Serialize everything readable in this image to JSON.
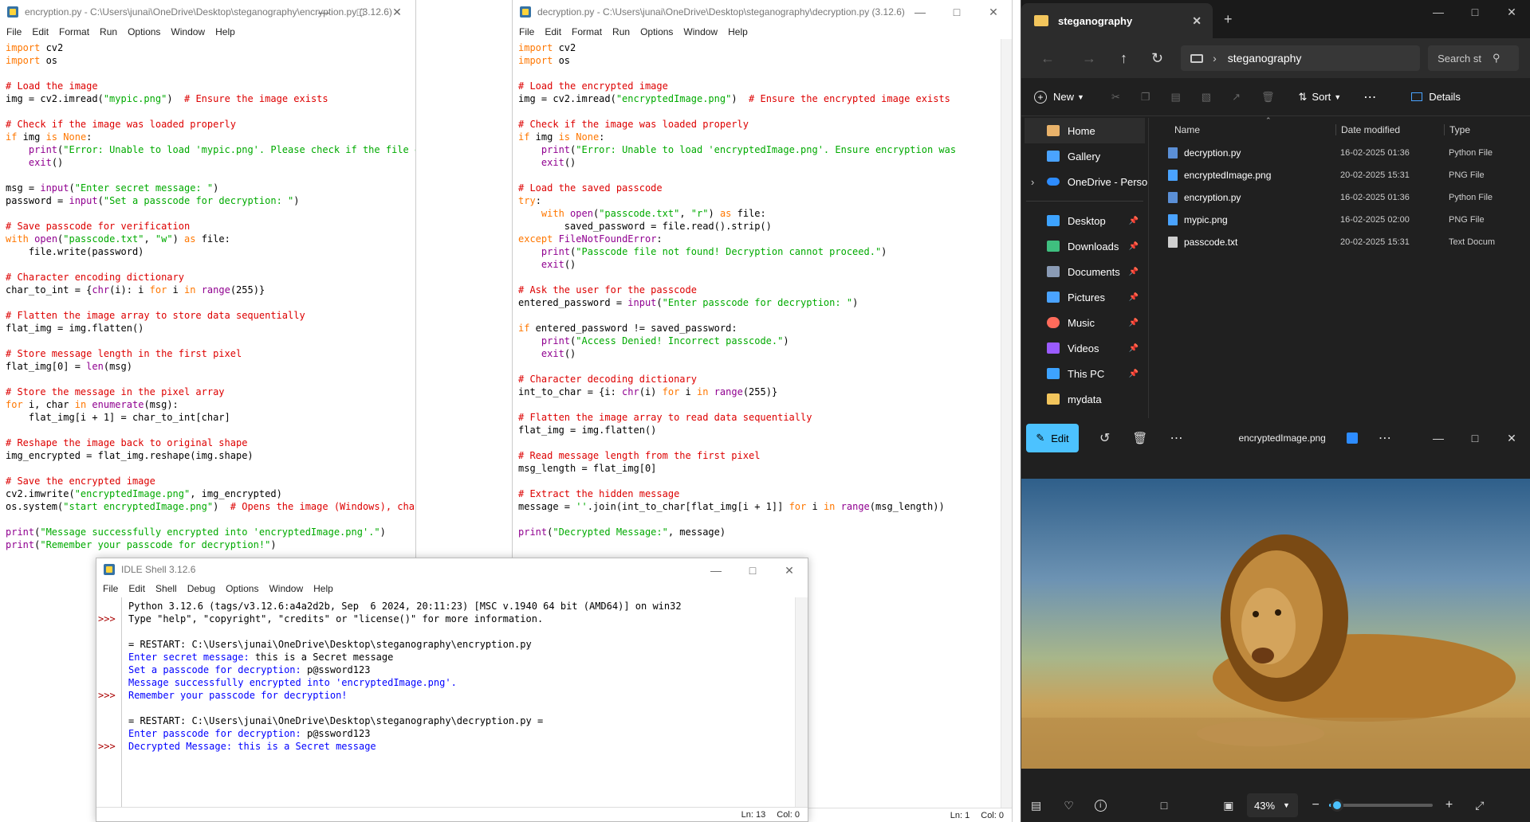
{
  "enc": {
    "title": "encryption.py - C:\\Users\\junai\\OneDrive\\Desktop\\steganography\\encryption.py (3.12.6)",
    "menu": [
      "File",
      "Edit",
      "Format",
      "Run",
      "Options",
      "Window",
      "Help"
    ]
  },
  "dec": {
    "title": "decryption.py - C:\\Users\\junai\\OneDrive\\Desktop\\steganography\\decryption.py (3.12.6)",
    "menu": [
      "File",
      "Edit",
      "Format",
      "Run",
      "Options",
      "Window",
      "Help"
    ],
    "status": {
      "ln": "Ln: 1",
      "col": "Col: 0"
    }
  },
  "shell": {
    "title": "IDLE Shell 3.12.6",
    "menu": [
      "File",
      "Edit",
      "Shell",
      "Debug",
      "Options",
      "Window",
      "Help"
    ],
    "status": {
      "ln": "Ln: 13",
      "col": "Col: 0"
    },
    "prompt": ">>>",
    "lines": {
      "banner1": "Python 3.12.6 (tags/v3.12.6:a4a2d2b, Sep  6 2024, 20:11:23) [MSC v.1940 64 bit (AMD64)] on win32",
      "banner2": "Type \"help\", \"copyright\", \"credits\" or \"license()\" for more information.",
      "restart1": "= RESTART: C:\\Users\\junai\\OneDrive\\Desktop\\steganography\\encryption.py",
      "out1": "Enter secret message: ",
      "in1": "this is a Secret message",
      "out2": "Set a passcode for decryption: ",
      "in2": "p@ssword123",
      "out3": "Message successfully encrypted into 'encryptedImage.png'.",
      "out4": "Remember your passcode for decryption!",
      "restart2": "= RESTART: C:\\Users\\junai\\OneDrive\\Desktop\\steganography\\decryption.py =",
      "out5": "Enter passcode for decryption: ",
      "in3": "p@ssword123",
      "out6": "Decrypted Message: this is a Secret message"
    }
  },
  "explorer": {
    "tab": "steganography",
    "address": "steganography",
    "search": "Search st",
    "new": "New",
    "sort": "Sort",
    "details": "Details",
    "sidebar": [
      {
        "label": "Home",
        "icon": "home-icon",
        "color": "#e8b26a"
      },
      {
        "label": "Gallery",
        "icon": "gallery-icon",
        "color": "#4aa3ff"
      },
      {
        "label": "OneDrive - Persona",
        "icon": "cloud-icon",
        "color": "#2d8cff"
      },
      {
        "label": "Desktop",
        "icon": "desktop-icon",
        "color": "#3da3ff"
      },
      {
        "label": "Downloads",
        "icon": "download-icon",
        "color": "#3fbf7f"
      },
      {
        "label": "Documents",
        "icon": "documents-icon",
        "color": "#8a9bb5"
      },
      {
        "label": "Pictures",
        "icon": "pictures-icon",
        "color": "#4aa3ff"
      },
      {
        "label": "Music",
        "icon": "music-icon",
        "color": "#ff6b5b"
      },
      {
        "label": "Videos",
        "icon": "videos-icon",
        "color": "#9b5bff"
      },
      {
        "label": "This PC",
        "icon": "pc-icon",
        "color": "#3da3ff"
      },
      {
        "label": "mydata",
        "icon": "folder-icon",
        "color": "#f2c55c"
      }
    ],
    "columns": [
      "Name",
      "Date modified",
      "Type"
    ],
    "files": [
      {
        "name": "decryption.py",
        "date": "16-02-2025 01:36",
        "type": "Python File"
      },
      {
        "name": "encryptedImage.png",
        "date": "20-02-2025 15:31",
        "type": "PNG File"
      },
      {
        "name": "encryption.py",
        "date": "16-02-2025 01:36",
        "type": "Python File"
      },
      {
        "name": "mypic.png",
        "date": "16-02-2025 02:00",
        "type": "PNG File"
      },
      {
        "name": "passcode.txt",
        "date": "20-02-2025 15:31",
        "type": "Text Docum"
      }
    ]
  },
  "photos": {
    "edit": "Edit",
    "filename": "encryptedImage.png",
    "zoom": "43%",
    "zoom_level": 0.08
  }
}
